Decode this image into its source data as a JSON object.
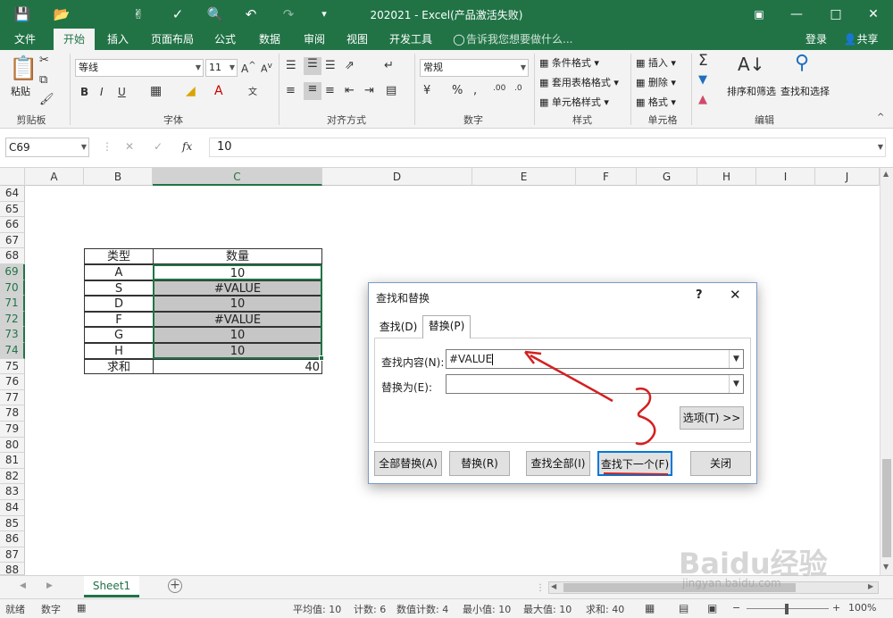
{
  "window": {
    "title": "202021 - Excel(产品激活失败)"
  },
  "tabs": [
    "文件",
    "开始",
    "插入",
    "页面布局",
    "公式",
    "数据",
    "审阅",
    "视图",
    "开发工具"
  ],
  "tell_me": "告诉我您想要做什么...",
  "login": "登录",
  "share": "共享",
  "ribbon": {
    "paste": "粘贴",
    "font_name": "等线",
    "font_size": "11",
    "number_format": "常规",
    "cond_format": "条件格式",
    "table_format": "套用表格格式",
    "cell_style": "单元格样式",
    "insert": "插入",
    "delete": "删除",
    "format": "格式",
    "sort_filter": "排序和筛选",
    "find_select": "查找和选择",
    "groups": {
      "clipboard": "剪贴板",
      "font": "字体",
      "align": "对齐方式",
      "number": "数字",
      "styles": "样式",
      "cells": "单元格",
      "edit": "编辑"
    }
  },
  "formula": {
    "name_box": "C69",
    "fx": "fx",
    "value": "10"
  },
  "columns": [
    "A",
    "B",
    "C",
    "D",
    "E",
    "F",
    "G",
    "H",
    "I",
    "J"
  ],
  "rows": [
    "64",
    "65",
    "66",
    "67",
    "68",
    "69",
    "70",
    "71",
    "72",
    "73",
    "74",
    "75",
    "76",
    "77",
    "78",
    "79",
    "80",
    "81",
    "82",
    "83",
    "84",
    "85",
    "86",
    "87",
    "88"
  ],
  "table": {
    "header": [
      "类型",
      "数量"
    ],
    "rows": [
      {
        "type": "A",
        "value": "10"
      },
      {
        "type": "S",
        "value": "#VALUE"
      },
      {
        "type": "D",
        "value": "10"
      },
      {
        "type": "F",
        "value": "#VALUE"
      },
      {
        "type": "G",
        "value": "10"
      },
      {
        "type": "H",
        "value": "10"
      }
    ],
    "sum_label": "求和",
    "sum_value": "40"
  },
  "dialog": {
    "title": "查找和替换",
    "help": "?",
    "tab_find": "查找(D)",
    "tab_replace": "替换(P)",
    "find_label": "查找内容(N):",
    "find_value": "#VALUE",
    "replace_label": "替换为(E):",
    "replace_value": "",
    "options_btn": "选项(T) >>",
    "replace_all": "全部替换(A)",
    "replace": "替换(R)",
    "find_all": "查找全部(I)",
    "find_next": "查找下一个(F)",
    "close": "关闭"
  },
  "sheet_tab": "Sheet1",
  "status": {
    "ready": "就绪",
    "mode": "数字",
    "average": "平均值: 10",
    "count": "计数: 6",
    "numcount": "数值计数: 4",
    "min": "最小值: 10",
    "max": "最大值: 10",
    "sum": "求和: 40",
    "zoom": "100%"
  },
  "watermark": {
    "brand": "Baidu经验",
    "url": "jingyan.baidu.com"
  },
  "colors": {
    "excel_green": "#217346",
    "annotation_red": "#d42020"
  }
}
